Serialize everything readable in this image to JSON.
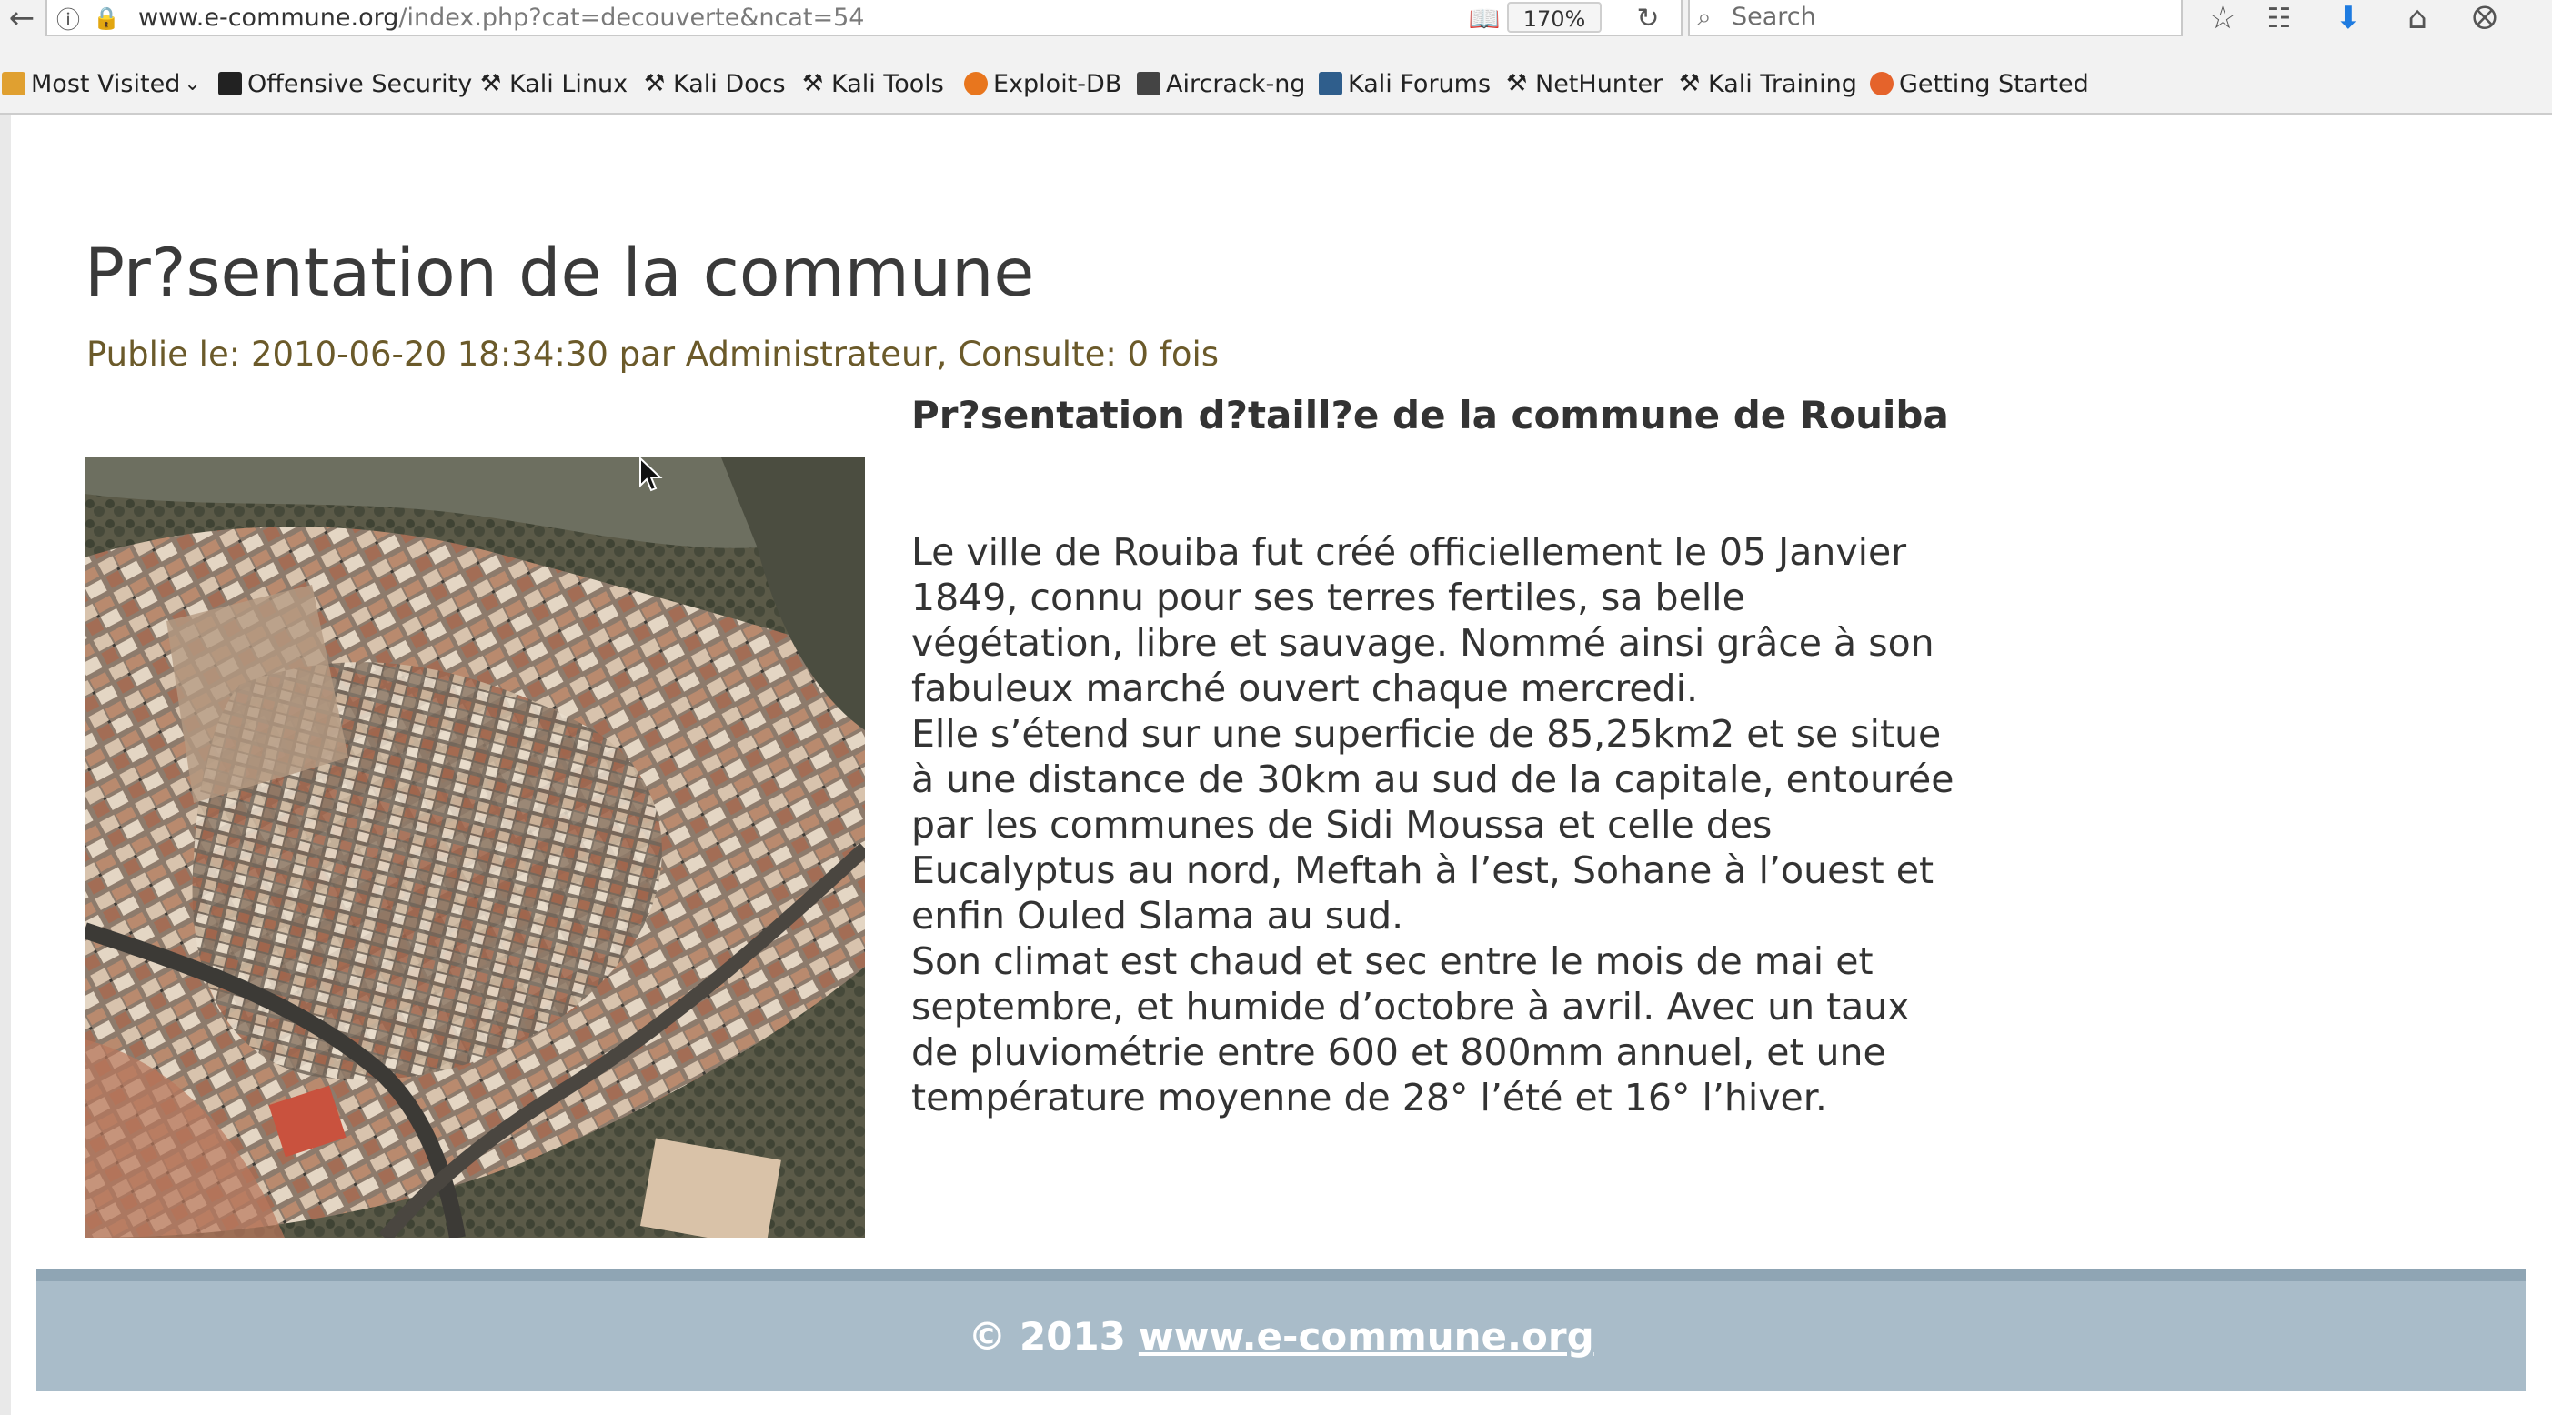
{
  "browser": {
    "url_domain": "www.e-commune.org",
    "url_path": "/index.php?cat=decouverte&ncat=54",
    "zoom": "170%",
    "search_placeholder": "Search"
  },
  "bookmarks": [
    {
      "label": "Most Visited",
      "icon": "most-visited-icon",
      "color": "#e0a030"
    },
    {
      "label": "Offensive Security",
      "icon": "offsec-icon",
      "color": "#222222"
    },
    {
      "label": "Kali Linux",
      "icon": "kali-dragon-icon",
      "color": "#333333"
    },
    {
      "label": "Kali Docs",
      "icon": "kali-dragon-icon",
      "color": "#333333"
    },
    {
      "label": "Kali Tools",
      "icon": "kali-dragon-icon",
      "color": "#333333"
    },
    {
      "label": "Exploit-DB",
      "icon": "exploitdb-icon",
      "color": "#e8761e"
    },
    {
      "label": "Aircrack-ng",
      "icon": "aircrack-icon",
      "color": "#444444"
    },
    {
      "label": "Kali Forums",
      "icon": "kali-forums-icon",
      "color": "#2f5e8c"
    },
    {
      "label": "NetHunter",
      "icon": "kali-dragon-icon",
      "color": "#333333"
    },
    {
      "label": "Kali Training",
      "icon": "kali-dragon-icon",
      "color": "#333333"
    },
    {
      "label": "Getting Started",
      "icon": "firefox-icon",
      "color": "#e5632b"
    }
  ],
  "article": {
    "title": "Pr?sentation de la commune",
    "meta": "Publie le: 2010-06-20 18:34:30 par Administrateur, Consulte: 0 fois",
    "subtitle": "Pr?sentation d?taill?e de la commune de Rouiba",
    "paragraphs": [
      "Le ville de Rouiba fut créé officiellement le 05 Janvier 1849, connu pour ses terres fertiles, sa belle végétation, libre et sauvage. Nommé ainsi grâce à son fabuleux marché ouvert chaque mercredi.",
      "Elle s’étend sur une superficie de 85,25km2 et se situe à une distance de 30km au sud de la capitale, entourée par les communes de Sidi Moussa et celle des Eucalyptus au nord, Meftah à l’est, Sohane à l’ouest et enfin Ouled Slama au sud.",
      "Son climat est chaud et sec entre le mois de mai et septembre, et humide d’octobre à avril. Avec un taux de pluviométrie entre 600 et 800mm annuel, et une température moyenne de 28° l’été et 16° l’hiver."
    ]
  },
  "footer": {
    "copyright": "© 2013",
    "link": "www.e-commune.org"
  },
  "colors": {
    "meta_text": "#6b5a2a",
    "footer_bg": "#a9bcc9",
    "footer_border": "#8fa5b4"
  }
}
